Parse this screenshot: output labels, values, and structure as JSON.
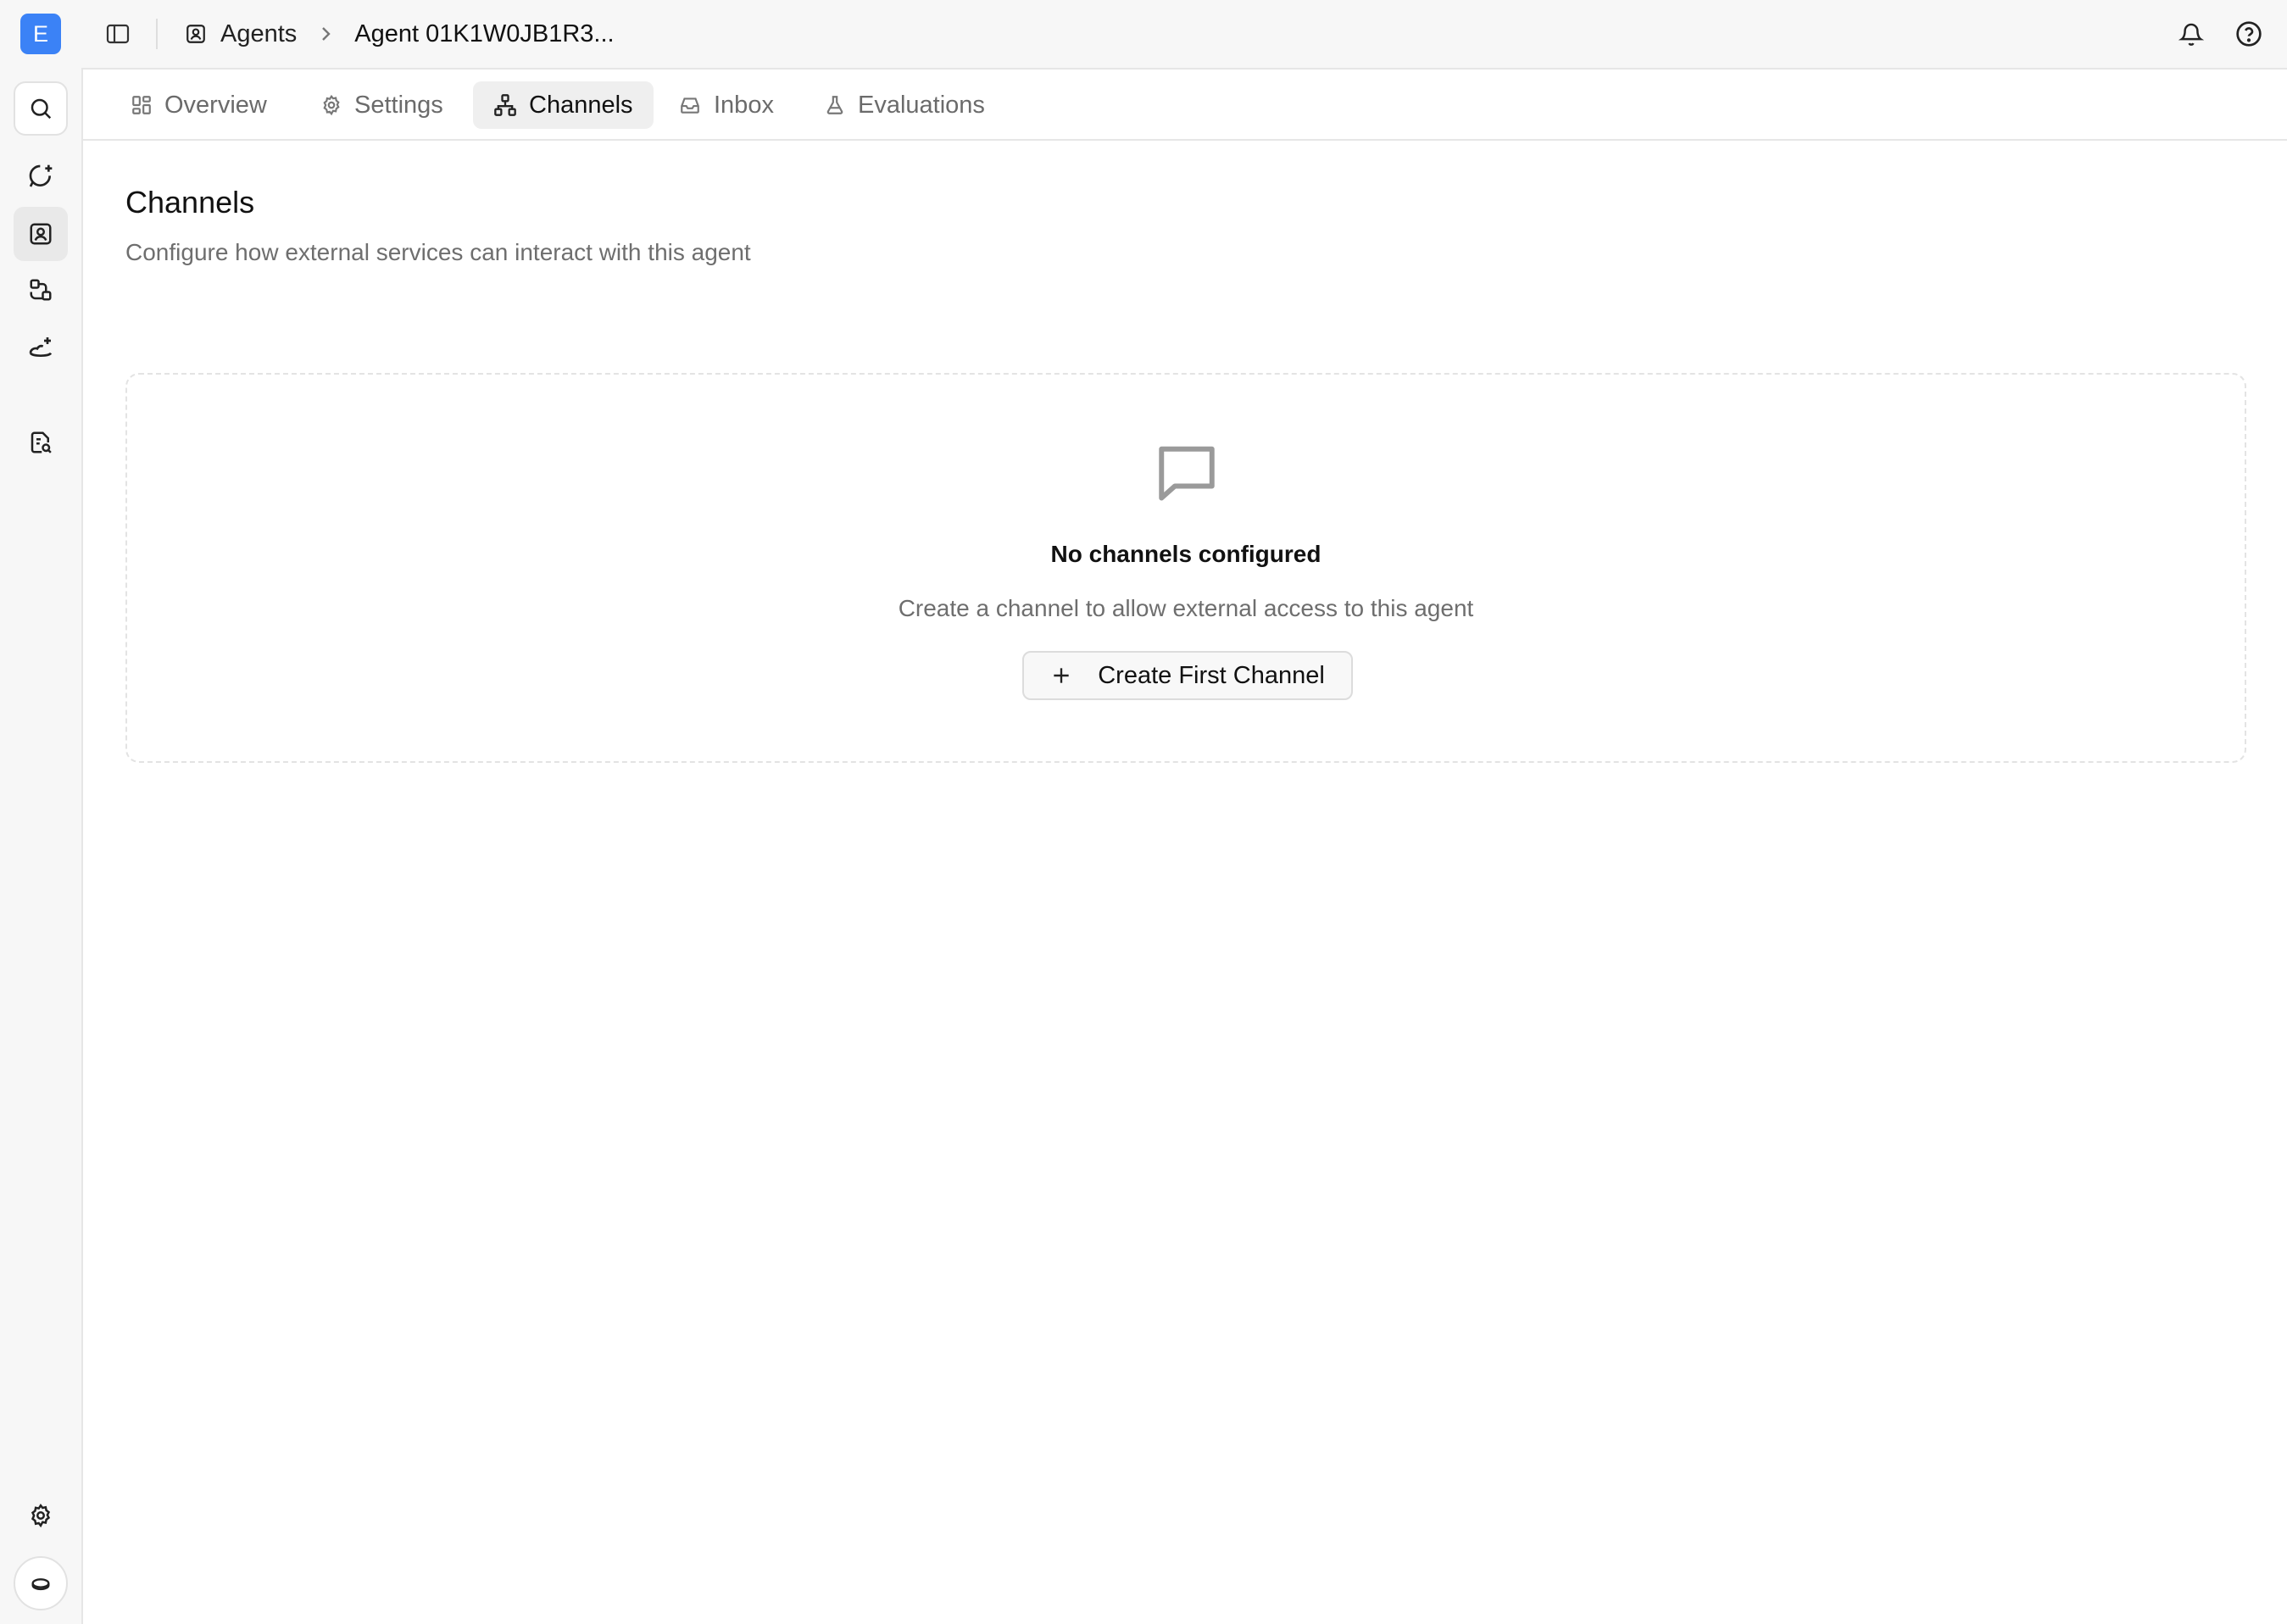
{
  "workspace": {
    "initial": "E"
  },
  "breadcrumb": {
    "section": "Agents",
    "current": "Agent 01K1W0JB1R3..."
  },
  "tabs": [
    {
      "label": "Overview",
      "icon": "grid-icon"
    },
    {
      "label": "Settings",
      "icon": "gear-icon"
    },
    {
      "label": "Channels",
      "icon": "network-icon",
      "active": true
    },
    {
      "label": "Inbox",
      "icon": "inbox-icon"
    },
    {
      "label": "Evaluations",
      "icon": "flask-icon"
    }
  ],
  "page": {
    "title": "Channels",
    "subtitle": "Configure how external services can interact with this agent"
  },
  "empty_state": {
    "icon": "message-square-icon",
    "title": "No channels configured",
    "description": "Create a channel to allow external access to this agent",
    "button_label": "Create First Channel"
  },
  "colors": {
    "accent": "#3b82f6",
    "active_tab_bg": "#efefef",
    "muted_text": "#6e6e6e"
  }
}
